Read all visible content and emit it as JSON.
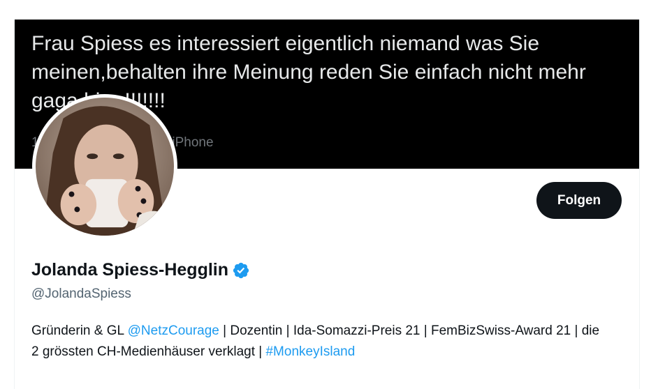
{
  "banner": {
    "text": "Frau Spiess es interessiert eigentlich niemand was Sie meinen,behalten ihre Meinung reden Sie einfach nicht mehr gaga hier !!!!!!!",
    "meta": "1 Apr. 2022 · Twitter for iPhone"
  },
  "follow_label": "Folgen",
  "profile": {
    "name": "Jolanda Spiess-Hegglin",
    "handle": "@JolandaSpiess",
    "bio": {
      "part1": "Gründerin & GL ",
      "mention": "@NetzCourage",
      "part2": " | Dozentin | Ida-Somazzi-Preis 21 | FemBizSwiss-Award 21 | die 2 grössten CH-Medienhäuser verklagt | ",
      "hashtag": "#MonkeyIsland"
    }
  },
  "icons": {
    "verified": "verified-badge-icon",
    "verified_color": "#1d9bf0"
  },
  "colors": {
    "banner_bg": "#000000",
    "button_bg": "#0f1419",
    "link": "#1d9bf0",
    "secondary_text": "#536471"
  }
}
